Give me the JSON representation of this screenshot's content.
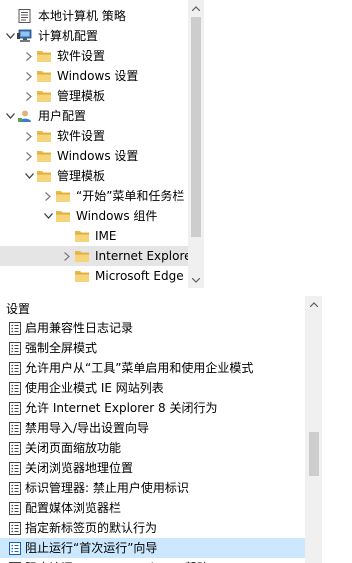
{
  "tree": {
    "items": [
      {
        "label": "本地计算机 策略",
        "icon": "policy-document-icon",
        "expander": "none",
        "depth": 0
      },
      {
        "label": "计算机配置",
        "icon": "computer-icon",
        "expander": "expanded",
        "depth": 0
      },
      {
        "label": "软件设置",
        "icon": "folder-icon",
        "expander": "collapsed",
        "depth": 1
      },
      {
        "label": "Windows 设置",
        "icon": "folder-icon",
        "expander": "collapsed",
        "depth": 1
      },
      {
        "label": "管理模板",
        "icon": "folder-icon",
        "expander": "collapsed",
        "depth": 1
      },
      {
        "label": "用户配置",
        "icon": "user-icon",
        "expander": "expanded",
        "depth": 0
      },
      {
        "label": "软件设置",
        "icon": "folder-icon",
        "expander": "collapsed",
        "depth": 1
      },
      {
        "label": "Windows 设置",
        "icon": "folder-icon",
        "expander": "collapsed",
        "depth": 1
      },
      {
        "label": "管理模板",
        "icon": "folder-icon",
        "expander": "expanded",
        "depth": 1
      },
      {
        "label": "“开始”菜单和任务栏",
        "icon": "folder-icon",
        "expander": "collapsed",
        "depth": 2
      },
      {
        "label": "Windows 组件",
        "icon": "folder-icon",
        "expander": "expanded",
        "depth": 2
      },
      {
        "label": "IME",
        "icon": "folder-icon",
        "expander": "none",
        "depth": 3
      },
      {
        "label": "Internet Explorer",
        "icon": "folder-icon",
        "expander": "collapsed",
        "depth": 3,
        "selected": true
      },
      {
        "label": "Microsoft Edge",
        "icon": "folder-icon",
        "expander": "none",
        "depth": 3
      }
    ]
  },
  "settings": {
    "column_header": "设置",
    "items": [
      {
        "label": "启用兼容性日志记录"
      },
      {
        "label": "强制全屏模式"
      },
      {
        "label": "允许用户从“工具”菜单启用和使用企业模式"
      },
      {
        "label": "使用企业模式 IE 网站列表"
      },
      {
        "label": "允许 Internet Explorer 8 关闭行为"
      },
      {
        "label": "禁用导入/导出设置向导"
      },
      {
        "label": "关闭页面缩放功能"
      },
      {
        "label": "关闭浏览器地理位置"
      },
      {
        "label": "标识管理器: 禁止用户使用标识"
      },
      {
        "label": "配置媒体浏览器栏"
      },
      {
        "label": "指定新标签页的默认行为"
      },
      {
        "label": "阻止运行“首次运行”向导",
        "selected": true
      },
      {
        "label": "阻止访问 Internet Explorer“帮助”"
      }
    ]
  },
  "colors": {
    "folder": "#e8b943",
    "folder_light": "#f6d57a",
    "selection_tree": "#e5e5e5",
    "selection_list": "#cce8ff",
    "scrollbar_track": "#f0f0f0",
    "scrollbar_thumb": "#cdcdcd"
  }
}
